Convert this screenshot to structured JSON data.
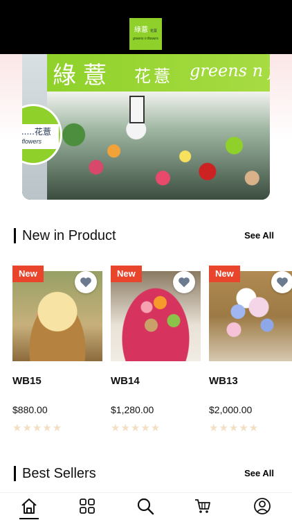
{
  "header": {
    "logo_cn": "綠薏",
    "logo_cn_small": "花薏",
    "logo_en": "greens n flowers"
  },
  "hero": {
    "sign_cn": "綠薏",
    "sign_cn2": "花薏",
    "sign_en": "greens n flo",
    "badge_cn": "薏......花薏",
    "badge_en": "s n flowers"
  },
  "new_in": {
    "title": "New in Product",
    "link": "See All",
    "products": [
      {
        "badge": "New",
        "name": "WB15",
        "price": "$880.00",
        "stars": "★★★★★"
      },
      {
        "badge": "New",
        "name": "WB14",
        "price": "$1,280.00",
        "stars": "★★★★★"
      },
      {
        "badge": "New",
        "name": "WB13",
        "price": "$2,000.00",
        "stars": "★★★★★"
      }
    ]
  },
  "best_sellers": {
    "title": "Best Sellers",
    "link": "See All"
  },
  "nav": {
    "items": [
      "home-icon",
      "grid-icon",
      "search-icon",
      "cart-icon",
      "profile-icon"
    ],
    "active": "home-icon"
  },
  "colors": {
    "brand_green": "#8fd12a",
    "badge_red": "#e9452c",
    "star_empty": "#f2dfc4"
  }
}
